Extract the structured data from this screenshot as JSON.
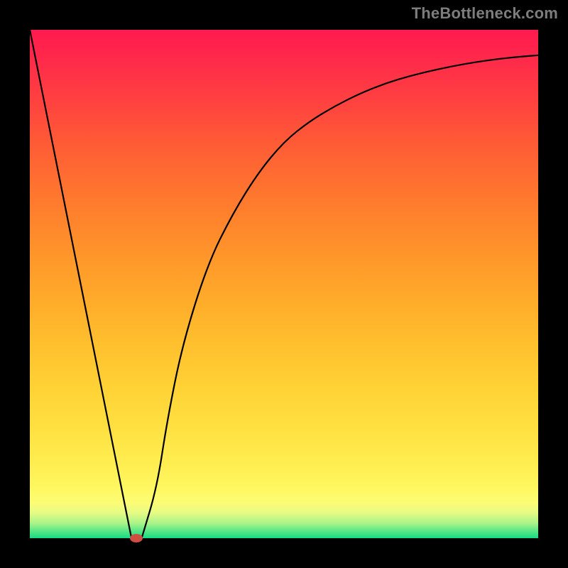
{
  "watermark": "TheBottleneck.com",
  "colors": {
    "frame": "#000000",
    "curve": "#000000",
    "marker": "#cf4e42",
    "watermark": "#7d7d7d"
  },
  "chart_data": {
    "type": "line",
    "title": "",
    "xlabel": "",
    "ylabel": "",
    "xlim": [
      0,
      100
    ],
    "ylim": [
      0,
      100
    ],
    "series": [
      {
        "name": "curve",
        "x": [
          0,
          5,
          10,
          15,
          18,
          20,
          22,
          25,
          27,
          30,
          35,
          40,
          45,
          50,
          55,
          60,
          65,
          70,
          75,
          80,
          85,
          90,
          95,
          100
        ],
        "values": [
          100,
          75,
          50,
          25,
          10,
          0,
          0,
          10,
          23,
          38,
          54,
          64,
          72,
          78,
          82,
          85,
          87.5,
          89.5,
          91,
          92.2,
          93.2,
          94,
          94.6,
          95
        ]
      }
    ],
    "marker": {
      "x": 21,
      "y": 0
    }
  }
}
